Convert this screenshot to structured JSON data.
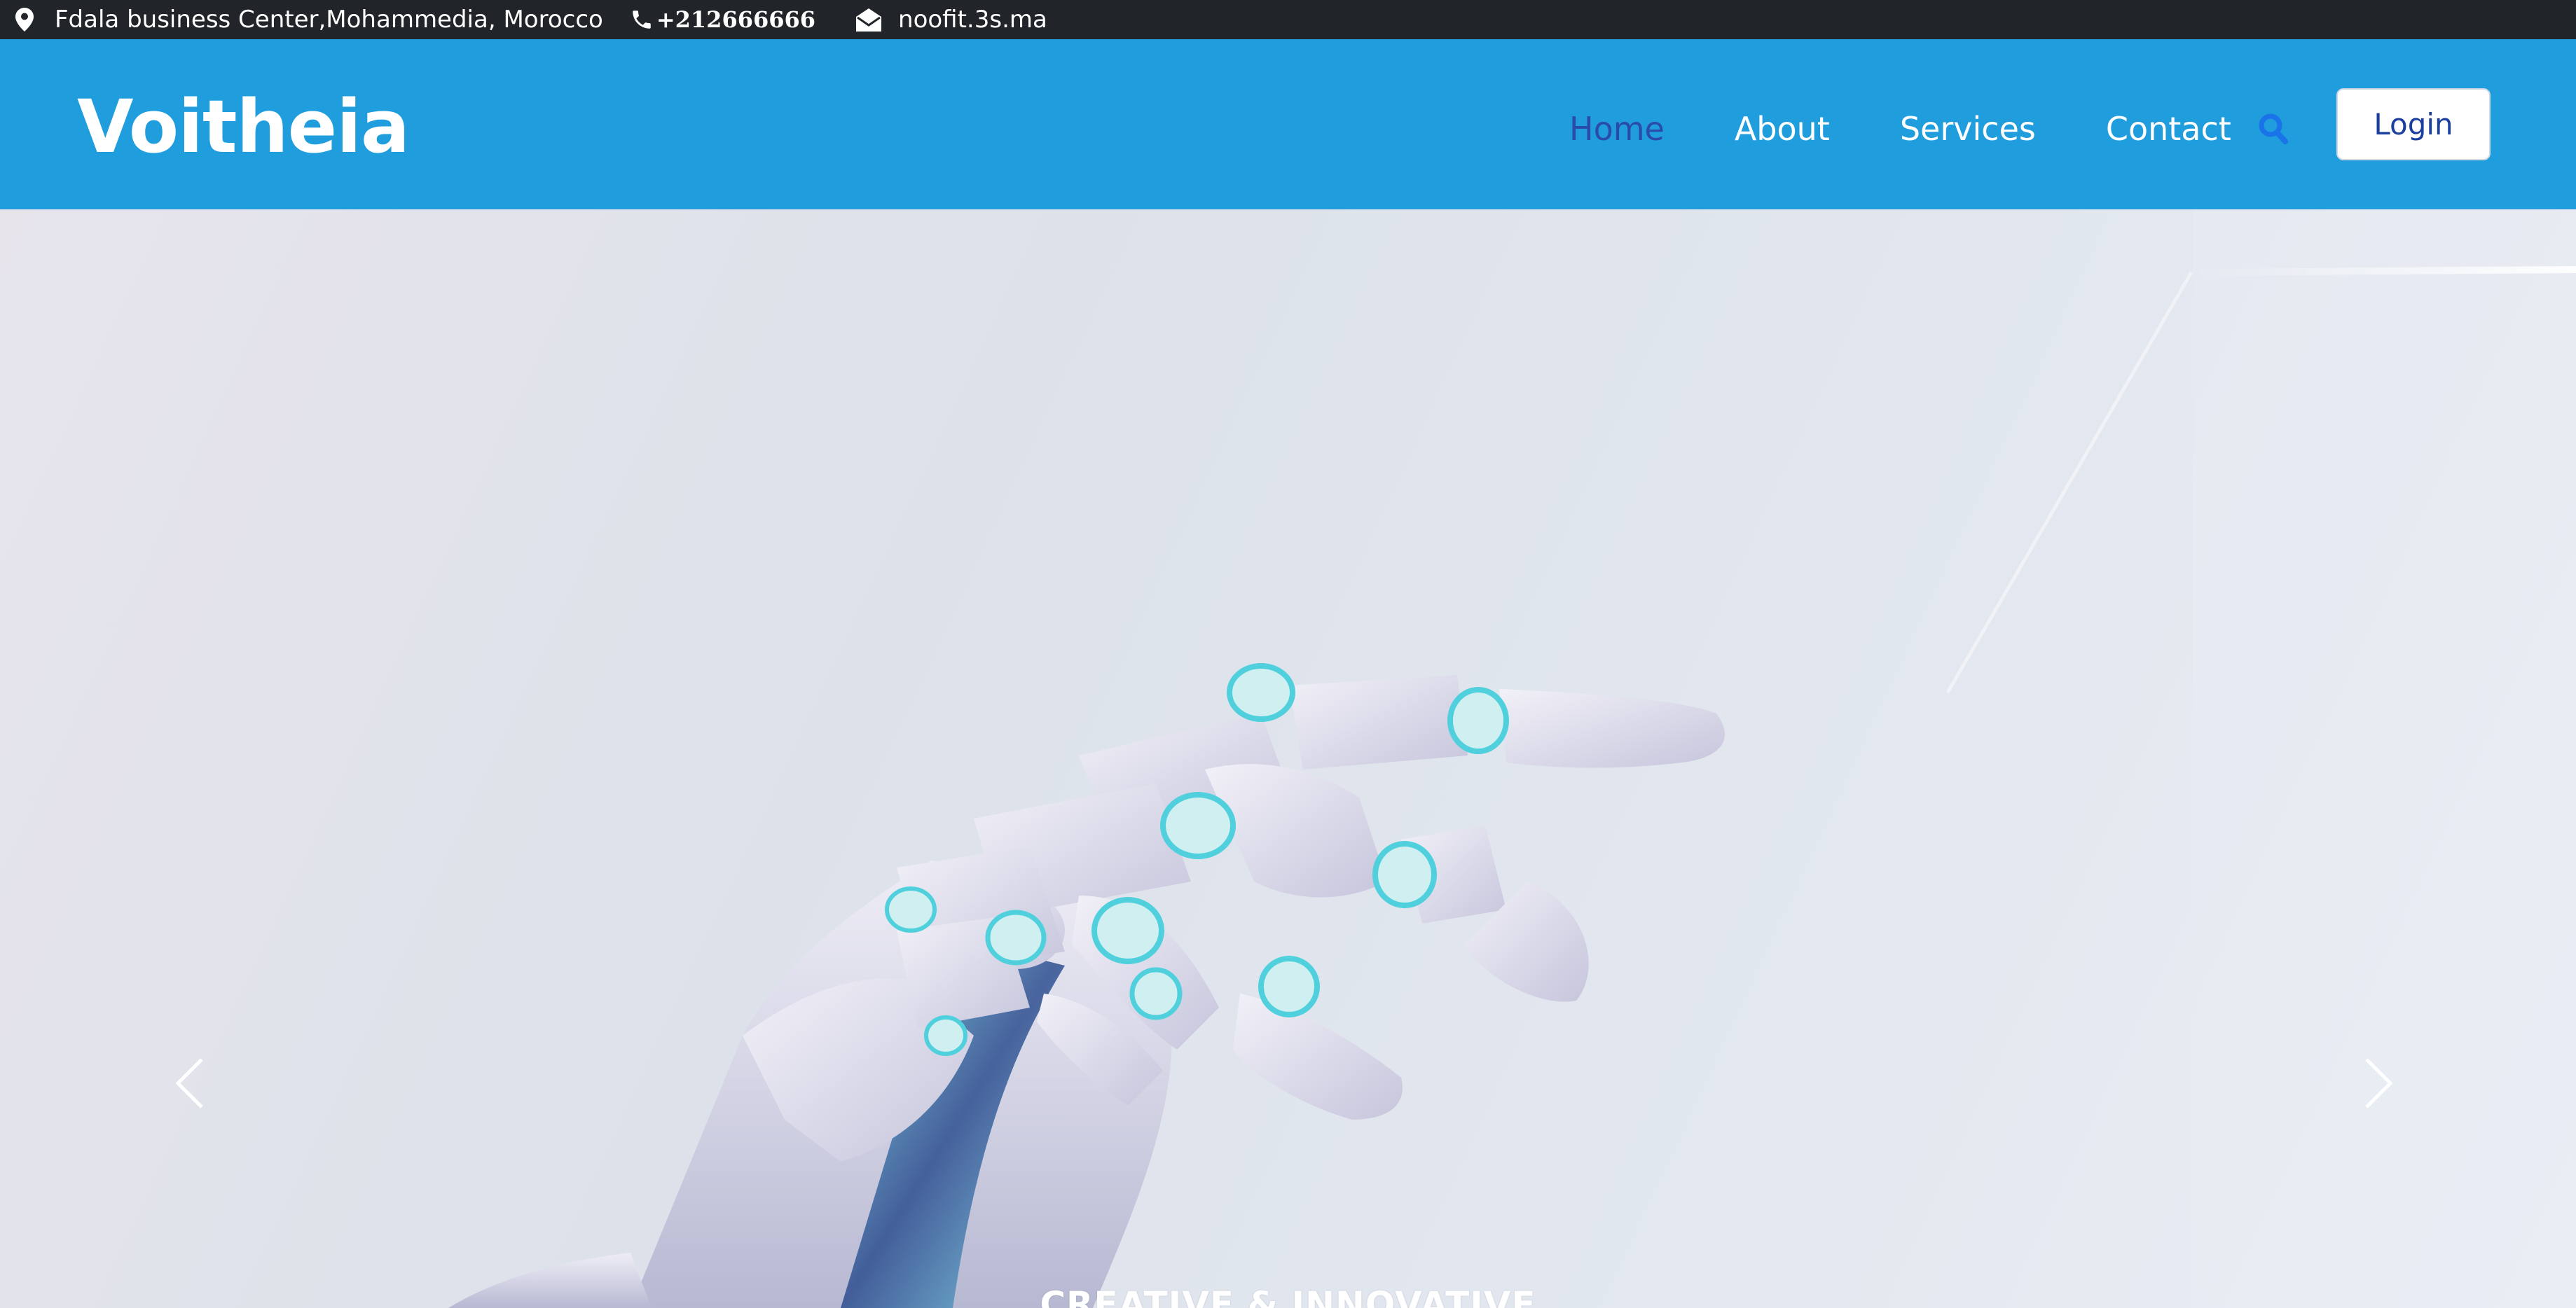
{
  "topbar": {
    "address": "Fdala business Center,Mohammedia, Morocco",
    "phone": "+212666666",
    "email": "noofit.3s.ma",
    "icons": {
      "address": "map-marker-icon",
      "phone": "phone-icon",
      "email": "envelope-open-icon"
    }
  },
  "navbar": {
    "brand": "Voitheia",
    "links": [
      {
        "label": "Home",
        "active": true
      },
      {
        "label": "About",
        "active": false
      },
      {
        "label": "Services",
        "active": false
      },
      {
        "label": "Contact",
        "active": false
      }
    ],
    "search_icon": "search-icon",
    "login_label": "Login"
  },
  "hero": {
    "caption": "CREATIVE & INNOVATIVE",
    "prev_icon": "chevron-left-icon",
    "next_icon": "chevron-right-icon",
    "image": "robotic-hand"
  },
  "colors": {
    "topbar_bg": "#212529",
    "navbar_bg": "#1f9ddd",
    "active_link": "#2a4ba8",
    "search_icon": "#1a73e8",
    "login_text": "#1a3f9e"
  }
}
